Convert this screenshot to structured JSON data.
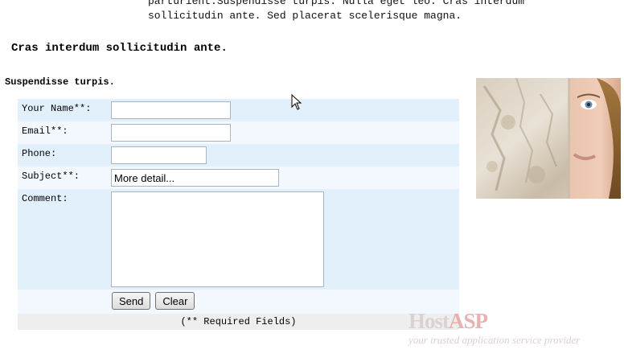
{
  "intro": {
    "line1": "parturient.Suspendisse turpis. Nulla eget leo. Cras interdum",
    "line2": "sollicitudin ante. Sed placerat scelerisque magna."
  },
  "heading": "Cras interdum sollicitudin ante.",
  "subheading": "Suspendisse turpis.",
  "form": {
    "name_label": "Your Name**:",
    "name_value": "",
    "email_label": "Email**:",
    "email_value": "",
    "phone_label": "Phone:",
    "phone_value": "",
    "subject_label": "Subject**:",
    "subject_value": "More detail...",
    "comment_label": "Comment:",
    "comment_value": "",
    "send_label": "Send",
    "clear_label": "Clear",
    "required_note": "(** Required Fields)"
  },
  "watermark": {
    "host": "Host",
    "asp": "ASP",
    "tagline": "your trusted application service provider"
  },
  "colors": {
    "row_alt_1": "#e2f0fc",
    "row_alt_2": "#f2f8fe",
    "footer_row": "#eeeeee"
  },
  "icons": {
    "cursor": "mouse-pointer-icon"
  }
}
